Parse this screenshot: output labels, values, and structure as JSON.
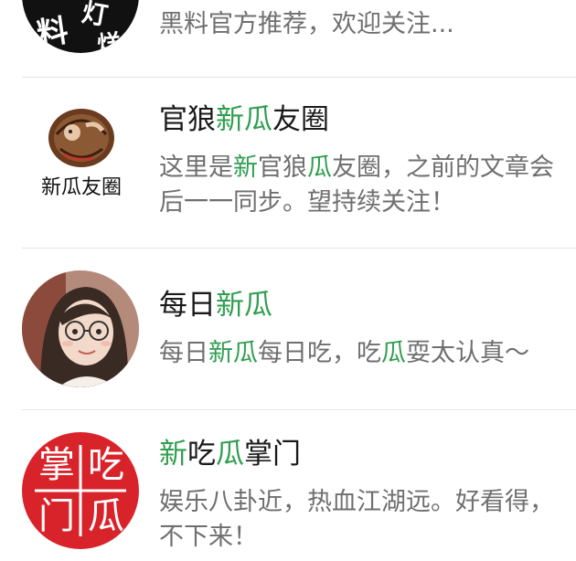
{
  "items": [
    {
      "avatar_chars": [
        "料",
        "灯",
        "烊"
      ],
      "description": "黑料官方推荐，欢迎关注..."
    },
    {
      "name_parts": [
        "官狼",
        "新瓜",
        "友圈"
      ],
      "avatar_label": "新瓜友圈",
      "desc_line1_parts": [
        "这里是",
        "新",
        "官狼",
        "瓜",
        "友圈，之前的文章会"
      ],
      "desc_line2": "后一一同步。望持续关注！"
    },
    {
      "name_parts": [
        "每日",
        "新瓜"
      ],
      "desc_parts": [
        "每日",
        "新瓜",
        "每日吃，吃",
        "瓜",
        "耍太认真～"
      ]
    },
    {
      "name_parts": [
        "新",
        "吃",
        "瓜",
        "掌门"
      ],
      "seal_chars": [
        "掌",
        "吃",
        "门",
        "瓜"
      ],
      "desc_line1": "娱乐八卦近，热血江湖远。好看得，",
      "desc_line2": "不下来！"
    }
  ],
  "colors": {
    "highlight": "#2f9e4f",
    "seal_red": "#d9232a",
    "divider": "#e3e3e3",
    "description_gray": "#6f6f6f"
  }
}
